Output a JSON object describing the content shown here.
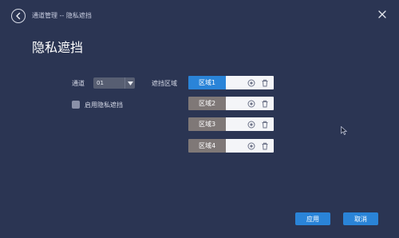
{
  "header": {
    "breadcrumb": "通道管理 -- 隐私遮挡"
  },
  "page": {
    "title": "隐私遮挡"
  },
  "form": {
    "channel_label": "通道",
    "channel_value": "01",
    "enable_label": "启用隐私遮挡",
    "enable_checked": false,
    "area_label": "遮挡区域"
  },
  "regions": [
    {
      "label": "区域1",
      "active": true
    },
    {
      "label": "区域2",
      "active": false
    },
    {
      "label": "区域3",
      "active": false
    },
    {
      "label": "区域4",
      "active": false
    }
  ],
  "icons": {
    "back": "back-arrow-icon",
    "close": "close-icon",
    "dropdown": "chevron-down-icon",
    "settings": "gear-icon",
    "delete": "trash-icon"
  },
  "colors": {
    "background": "#2b3553",
    "accent": "#2a84d8",
    "inactive_region": "#7f7877"
  },
  "footer": {
    "apply_label": "应用",
    "cancel_label": "取消"
  }
}
